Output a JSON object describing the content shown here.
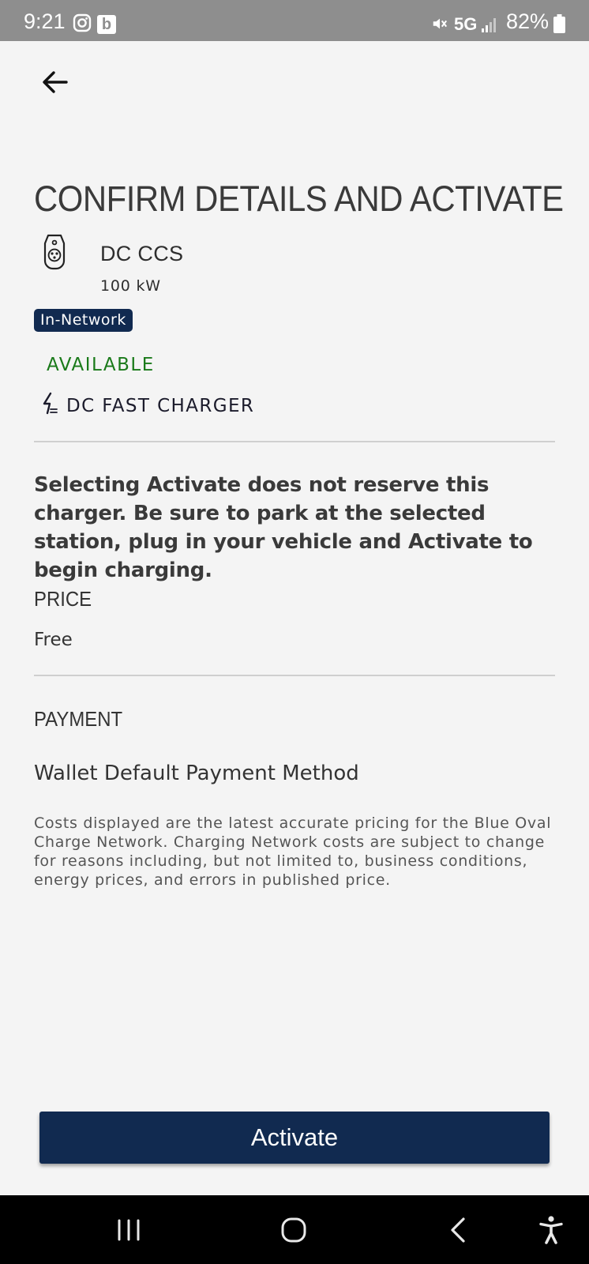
{
  "status_bar": {
    "time": "9:21",
    "network": "5G",
    "battery": "82%",
    "app_badge": "b",
    "icons": [
      "instagram-icon",
      "b-app-icon",
      "mute-icon",
      "signal-icon",
      "battery-icon"
    ]
  },
  "header": {
    "back_icon": "arrow-left-icon"
  },
  "title": "CONFIRM DETAILS AND ACTIVATE",
  "connector": {
    "icon": "ccs-connector-icon",
    "name": "DC CCS",
    "power": "100 kW"
  },
  "network_badge": "In-Network",
  "availability": "AVAILABLE",
  "charger_type": {
    "icon": "lightning-bolt-icon",
    "label": "DC FAST CHARGER"
  },
  "notice": "Selecting Activate does not reserve this charger. Be sure to park at the selected station, plug in your vehicle and Activate to begin charging.",
  "price": {
    "label": "PRICE",
    "value": "Free"
  },
  "payment": {
    "label": "PAYMENT",
    "value": "Wallet Default Payment Method"
  },
  "disclaimer": "Costs displayed are the latest accurate pricing for the Blue Oval Charge Network. Charging Network costs are subject to change for reasons including, but not limited to, business conditions, energy prices, and errors in published price.",
  "activate_button": "Activate",
  "colors": {
    "primary_navy": "#112a50",
    "available_green": "#1a7a1a",
    "background": "#f4f4f4",
    "status_bar": "#8e8e8e"
  },
  "nav_bar": {
    "icons": [
      "recents-icon",
      "home-icon",
      "back-icon",
      "accessibility-icon"
    ]
  }
}
